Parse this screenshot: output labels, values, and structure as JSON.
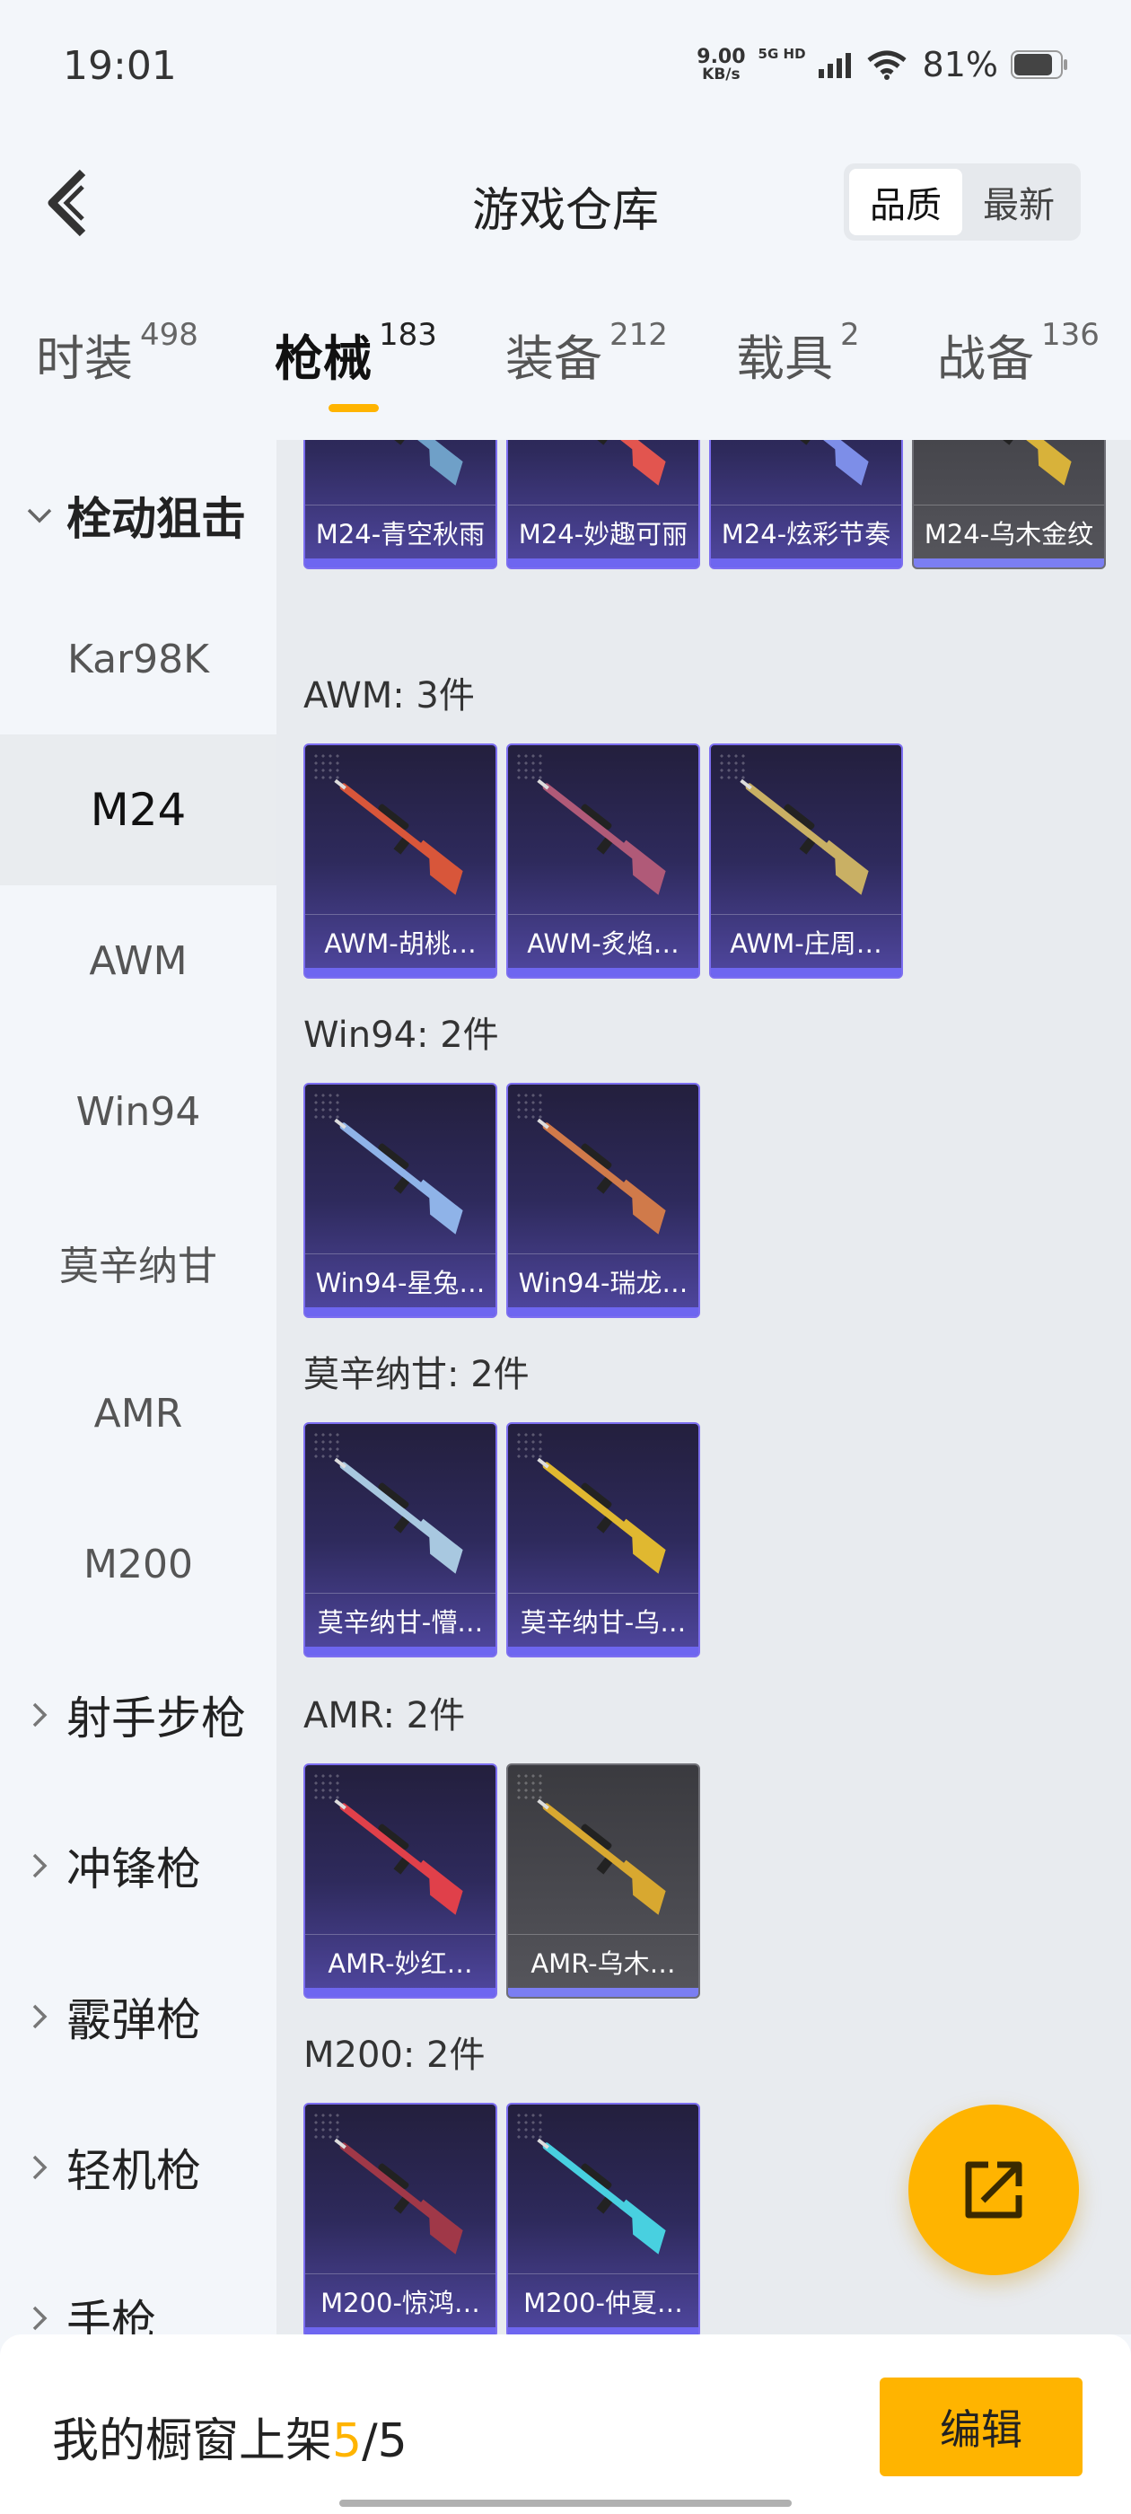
{
  "status_bar": {
    "time": "19:01",
    "net_speed_value": "9.00",
    "net_speed_unit": "KB/s",
    "signal_label": "5G HD",
    "battery": "81%"
  },
  "header": {
    "title": "游戏仓库",
    "sort_options": [
      "品质",
      "最新"
    ],
    "active_sort": "品质"
  },
  "category_tabs": [
    {
      "label": "时装",
      "count": "498"
    },
    {
      "label": "枪械",
      "count": "183",
      "active": true
    },
    {
      "label": "装备",
      "count": "212"
    },
    {
      "label": "载具",
      "count": "2"
    },
    {
      "label": "战备",
      "count": "136"
    }
  ],
  "left_nav": [
    {
      "label": "栓动狙击",
      "type": "group",
      "expanded": true
    },
    {
      "label": "Kar98K",
      "type": "item"
    },
    {
      "label": "M24",
      "type": "item",
      "selected": true
    },
    {
      "label": "AWM",
      "type": "item"
    },
    {
      "label": "Win94",
      "type": "item"
    },
    {
      "label": "莫辛纳甘",
      "type": "item"
    },
    {
      "label": "AMR",
      "type": "item"
    },
    {
      "label": "M200",
      "type": "item"
    },
    {
      "label": "射手步枪",
      "type": "group"
    },
    {
      "label": "冲锋枪",
      "type": "group"
    },
    {
      "label": "霰弹枪",
      "type": "group"
    },
    {
      "label": "轻机枪",
      "type": "group"
    },
    {
      "label": "手枪",
      "type": "group"
    }
  ],
  "sections": [
    {
      "title": "",
      "items": [
        {
          "name": "M24-青空秋雨",
          "quality": "purple",
          "color": "#6fa0c8"
        },
        {
          "name": "M24-妙趣可丽",
          "quality": "purple",
          "color": "#e2554f"
        },
        {
          "name": "M24-炫彩节奏",
          "quality": "purple",
          "color": "#7d8ee8"
        },
        {
          "name": "M24-乌木金纹",
          "quality": "gray",
          "color": "#d8b23a"
        }
      ]
    },
    {
      "title": "AWM: 3件",
      "items": [
        {
          "name": "AWM-胡桃…",
          "quality": "purple",
          "color": "#d8563a"
        },
        {
          "name": "AWM-炙焰…",
          "quality": "purple",
          "color": "#b05a78"
        },
        {
          "name": "AWM-庄周…",
          "quality": "purple",
          "color": "#c9b064"
        }
      ]
    },
    {
      "title": "Win94: 2件",
      "items": [
        {
          "name": "Win94-星兔…",
          "quality": "purple",
          "color": "#8fb3e8"
        },
        {
          "name": "Win94-瑞龙…",
          "quality": "purple",
          "color": "#d07a4a"
        }
      ]
    },
    {
      "title": "莫辛纳甘: 2件",
      "items": [
        {
          "name": "莫辛纳甘-懵…",
          "quality": "purple",
          "color": "#a8c8e0"
        },
        {
          "name": "莫辛纳甘-乌…",
          "quality": "purple",
          "color": "#e0b830"
        }
      ]
    },
    {
      "title": "AMR: 2件",
      "items": [
        {
          "name": "AMR-妙红…",
          "quality": "purple",
          "color": "#e0404a"
        },
        {
          "name": "AMR-乌木…",
          "quality": "gray",
          "color": "#d8a830"
        }
      ]
    },
    {
      "title": "M200: 2件",
      "items": [
        {
          "name": "M200-惊鸿…",
          "quality": "purple",
          "color": "#a03848"
        },
        {
          "name": "M200-仲夏…",
          "quality": "purple",
          "color": "#48d0e0"
        }
      ]
    }
  ],
  "bottom_bar": {
    "label": "我的橱窗上架",
    "current": "5",
    "separator": "/",
    "total": "5",
    "edit_label": "编辑"
  },
  "colors": {
    "accent": "#ffb400",
    "purple_border": "#7c6ef0",
    "gray_card": "#4a4a50"
  },
  "icons": [
    "back-icon",
    "share-icon",
    "chevron-right-icon",
    "chevron-down-icon",
    "wifi-icon",
    "signal-icon",
    "battery-icon"
  ]
}
